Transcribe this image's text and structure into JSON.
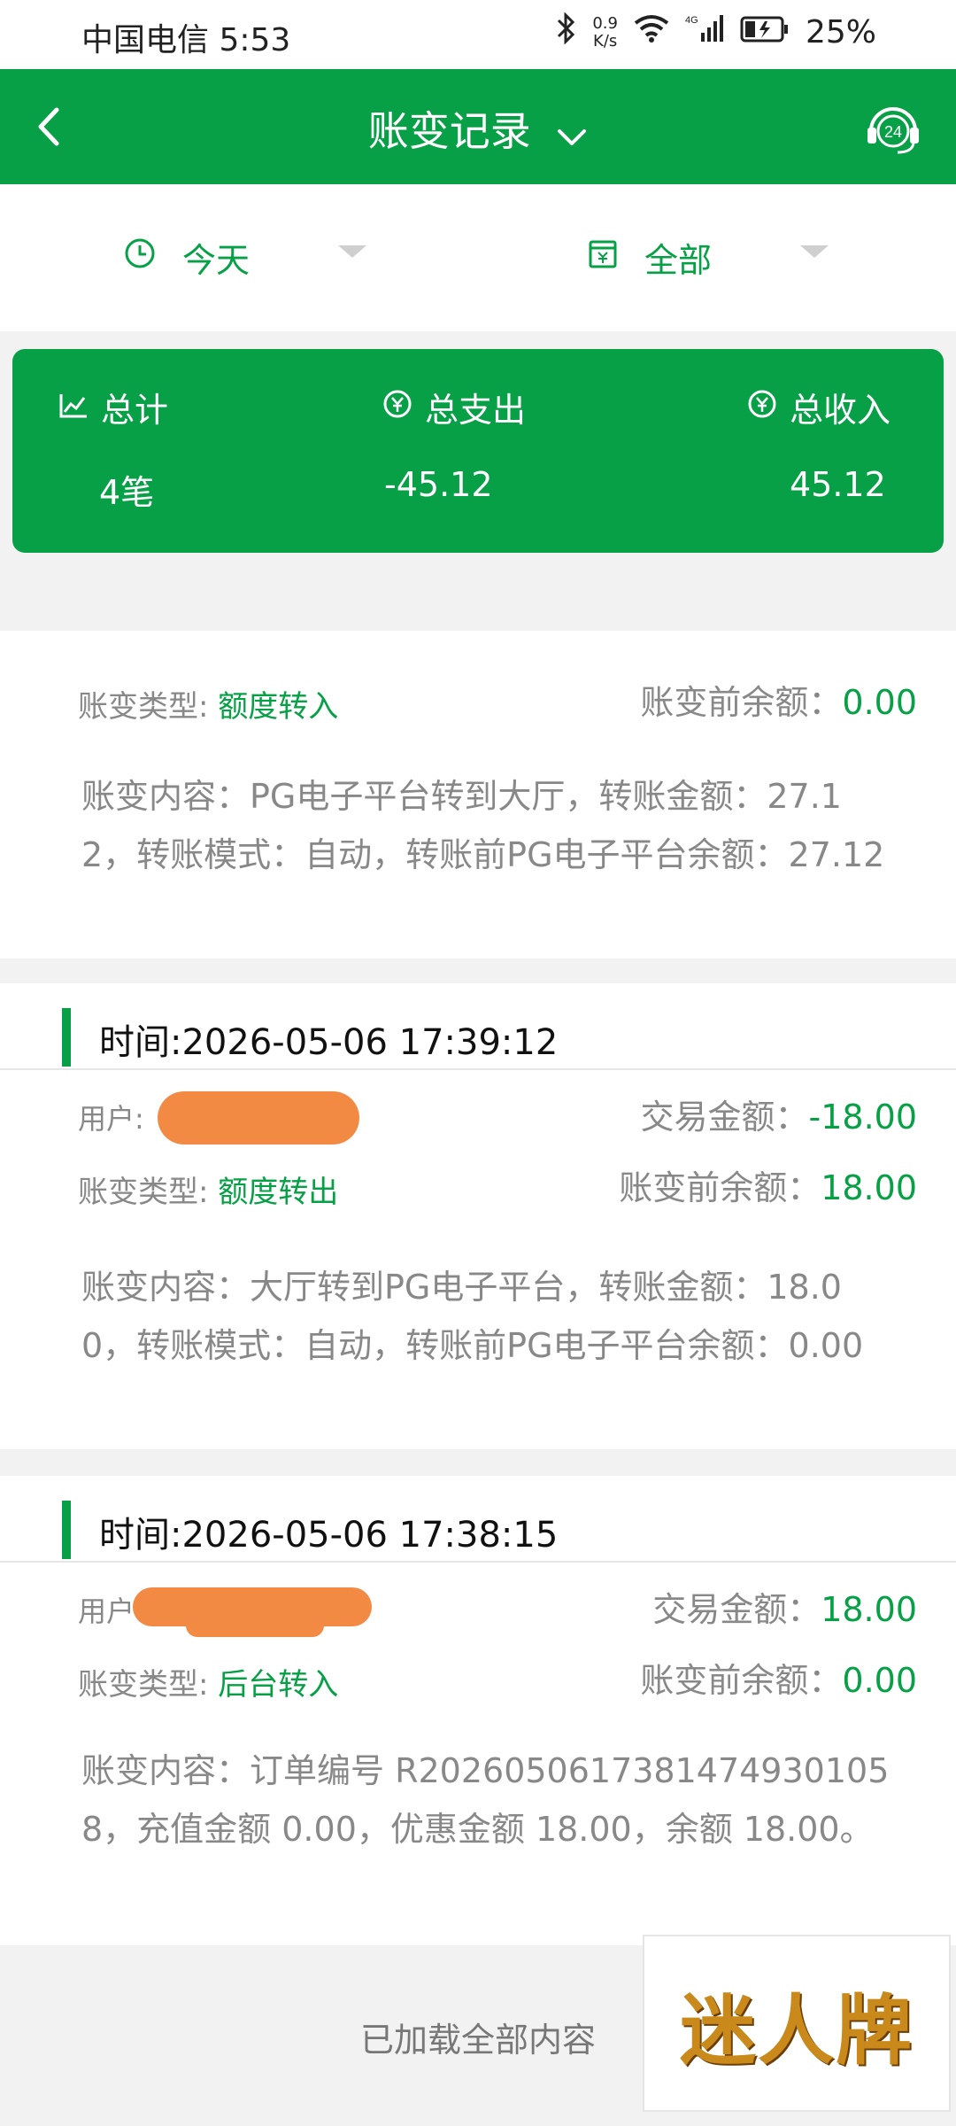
{
  "status_bar": {
    "carrier_time": "中国电信 5:53",
    "net_speed_value": "0.9",
    "net_speed_unit": "K/s",
    "signal_type": "4G",
    "battery": "25%"
  },
  "header": {
    "title": "账变记录",
    "support_badge": "24"
  },
  "filters": {
    "date": "今天",
    "type": "全部"
  },
  "summary": {
    "total_label": "总计",
    "total_value": "4笔",
    "expense_label": "总支出",
    "expense_value": "-45.12",
    "income_label": "总收入",
    "income_value": "45.12"
  },
  "records": [
    {
      "type_label": "账变类型:",
      "type_value": "额度转入",
      "balance_label": "账变前余额：",
      "balance_value": "0.00",
      "content": "账变内容：PG电子平台转到大厅，转账金额：27.12，转账模式：自动，转账前PG电子平台余额：27.12"
    },
    {
      "time": "时间:2026-05-06 17:39:12",
      "user_label": "用户:",
      "amount_label": "交易金额：",
      "amount_value": "-18.00",
      "type_label": "账变类型:",
      "type_value": "额度转出",
      "balance_label": "账变前余额：",
      "balance_value": "18.00",
      "content": "账变内容：大厅转到PG电子平台，转账金额：18.00，转账模式：自动，转账前PG电子平台余额：0.00"
    },
    {
      "time": "时间:2026-05-06 17:38:15",
      "user_label": "用户",
      "amount_label": "交易金额：",
      "amount_value": "18.00",
      "type_label": "账变类型:",
      "type_value": "后台转入",
      "balance_label": "账变前余额：",
      "balance_value": "0.00",
      "content": "账变内容：订单编号 R2026050617381474930105 8，充值金额 0.00，优惠金额 18.00，余额 18.00。"
    }
  ],
  "footer": {
    "loaded_text": "已加载全部内容",
    "logo_text": "迷人牌"
  },
  "colors": {
    "accent": "#07a046",
    "redaction": "#f28a43"
  }
}
